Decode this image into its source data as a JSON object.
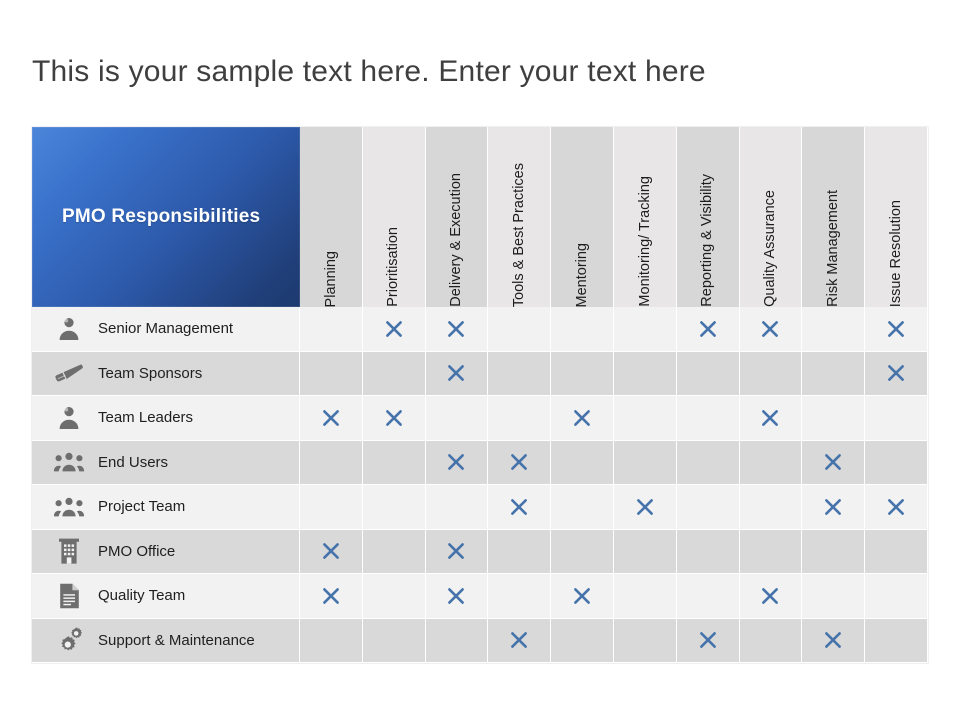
{
  "slide": {
    "title": "This is your sample text here. Enter your text here",
    "background_color": "#ffffff"
  },
  "matrix": {
    "corner_label": "PMO Responsibilities",
    "accent_color": "#3a72cb",
    "accent_color_dark": "#1d3a70",
    "mark_color": "#4673ab",
    "mark_glyph": "x-mark",
    "row_color_odd": "#f2f2f2",
    "row_color_even": "#d9d9d9",
    "header_color_odd": "#d7d7d7",
    "header_color_even": "#e8e6e6",
    "columns": [
      "Planning",
      "Prioritisation",
      "Delivery & Execution",
      "Tools & Best Practices",
      "Mentoring",
      "Monitoring/ Tracking",
      "Reporting & Visibility",
      "Quality Assurance",
      "Risk Management",
      "Issue Resolution"
    ],
    "rows": [
      {
        "label": "Senior Management",
        "icon": "person-icon",
        "marks": [
          false,
          true,
          true,
          false,
          false,
          false,
          true,
          true,
          false,
          true
        ]
      },
      {
        "label": "Team Sponsors",
        "icon": "megaphone-icon",
        "marks": [
          false,
          false,
          true,
          false,
          false,
          false,
          false,
          false,
          false,
          true
        ]
      },
      {
        "label": "Team Leaders",
        "icon": "person-icon",
        "marks": [
          true,
          true,
          false,
          false,
          true,
          false,
          false,
          true,
          false,
          false
        ]
      },
      {
        "label": "End Users",
        "icon": "people-group-icon",
        "marks": [
          false,
          false,
          true,
          true,
          false,
          false,
          false,
          false,
          true,
          false
        ]
      },
      {
        "label": "Project Team",
        "icon": "people-group-icon",
        "marks": [
          false,
          false,
          false,
          true,
          false,
          true,
          false,
          false,
          true,
          true
        ]
      },
      {
        "label": "PMO Office",
        "icon": "building-icon",
        "marks": [
          true,
          false,
          true,
          false,
          false,
          false,
          false,
          false,
          false,
          false
        ]
      },
      {
        "label": "Quality Team",
        "icon": "document-icon",
        "marks": [
          true,
          false,
          true,
          false,
          true,
          false,
          false,
          true,
          false,
          false
        ]
      },
      {
        "label": "Support & Maintenance",
        "icon": "gears-icon",
        "marks": [
          false,
          false,
          false,
          true,
          false,
          false,
          true,
          false,
          true,
          false
        ]
      }
    ]
  }
}
